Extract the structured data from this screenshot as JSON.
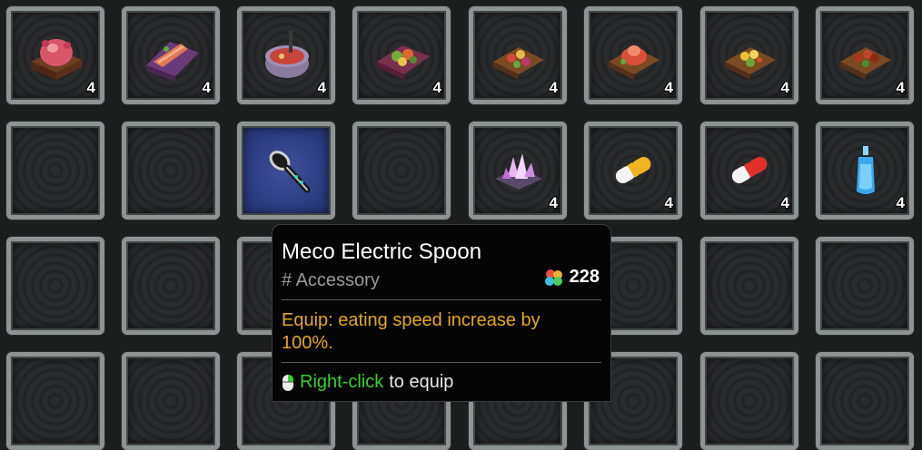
{
  "inventory": {
    "row1": [
      {
        "item": "pink-ornament-cake-icon",
        "count": "4"
      },
      {
        "item": "fish-platter-icon",
        "count": "4"
      },
      {
        "item": "stew-pot-icon",
        "count": "4"
      },
      {
        "item": "salad-platter-icon",
        "count": "4"
      },
      {
        "item": "berry-platter-icon",
        "count": "4"
      },
      {
        "item": "red-pudding-platter-icon",
        "count": "4"
      },
      {
        "item": "corn-platter-icon",
        "count": "4"
      },
      {
        "item": "meat-skewer-platter-icon",
        "count": "4"
      }
    ],
    "row2": [
      {
        "item": "",
        "count": ""
      },
      {
        "item": "",
        "count": ""
      },
      {
        "item": "electric-spoon-icon",
        "count": "",
        "selected": true
      },
      {
        "item": "",
        "count": ""
      },
      {
        "item": "crystal-cluster-icon",
        "count": "4"
      },
      {
        "item": "yellow-capsule-icon",
        "count": "4"
      },
      {
        "item": "red-capsule-icon",
        "count": "4"
      },
      {
        "item": "blue-vial-icon",
        "count": "4"
      }
    ]
  },
  "tooltip": {
    "title": "Meco Electric Spoon",
    "type": "# Accessory",
    "value": "228",
    "description": "Equip: eating speed increase by 100%.",
    "hint_action": "Right-click",
    "hint_rest": "to equip"
  },
  "colors": {
    "description": "#e5a81c",
    "action": "#35d12c",
    "selected_slot": "#2b3a80",
    "slot_border": "#8d9391"
  }
}
